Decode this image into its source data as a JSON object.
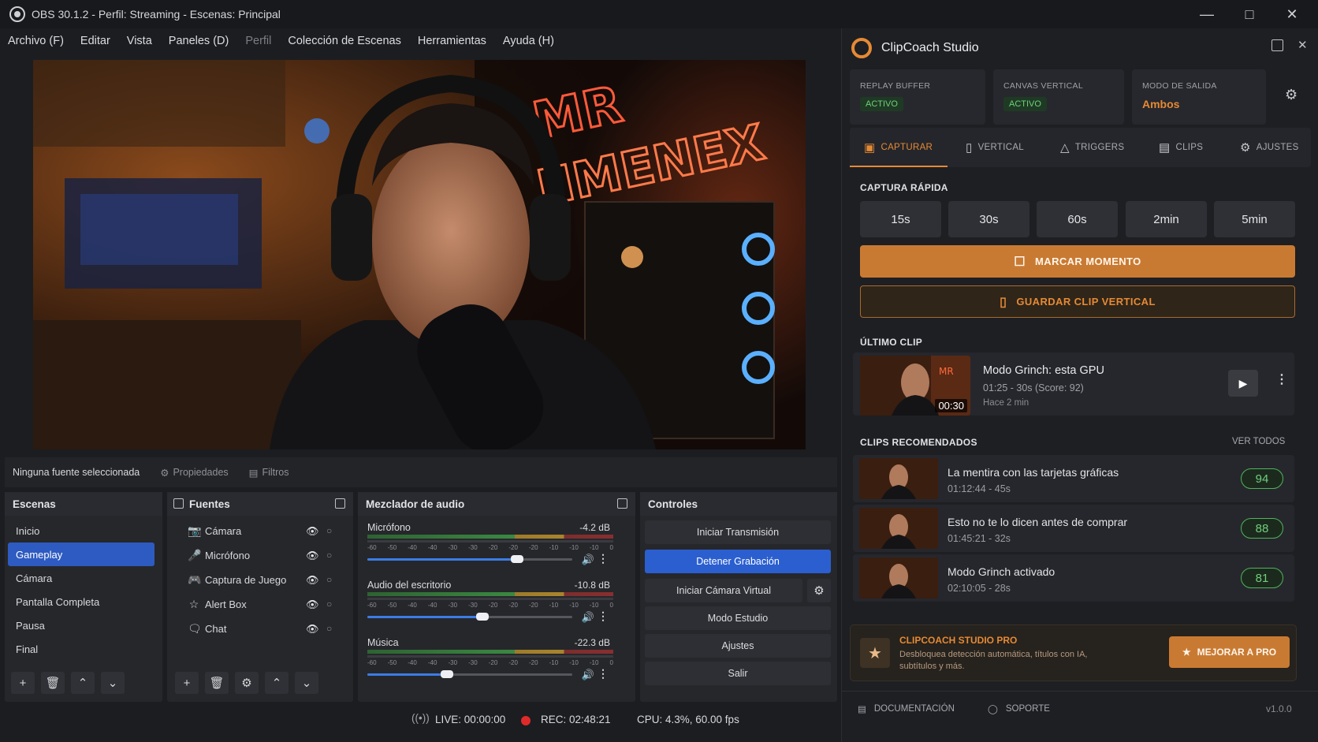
{
  "window": {
    "title": "OBS 30.1.2 - Perfil: Streaming - Escenas: Principal"
  },
  "menu": [
    "Archivo (F)",
    "Editar",
    "Vista",
    "Paneles (D)",
    "Perfil",
    "Colección de Escenas",
    "Herramientas",
    "Ayuda (H)"
  ],
  "preview": {
    "neon_line1": "MR",
    "neon_line2": "JIMENEX"
  },
  "source_bar": {
    "status": "Ninguna fuente seleccionada",
    "properties": "Propiedades",
    "filters": "Filtros"
  },
  "scenes": {
    "title": "Escenas",
    "items": [
      "Inicio",
      "Gameplay",
      "Cámara",
      "Pantalla Completa",
      "Pausa",
      "Final"
    ],
    "selected": "Gameplay"
  },
  "sources": {
    "title": "Fuentes",
    "items": [
      {
        "label": "Cámara",
        "icon": "camera-icon"
      },
      {
        "label": "Micrófono",
        "icon": "microphone-icon"
      },
      {
        "label": "Captura de Juego",
        "icon": "gamepad-icon"
      },
      {
        "label": "Alert Box",
        "icon": "star-icon"
      },
      {
        "label": "Chat",
        "icon": "chat-icon"
      }
    ]
  },
  "mixer": {
    "title": "Mezclador de audio",
    "ticks": [
      "-60",
      "-50",
      "-40",
      "-40",
      "-30",
      "-30",
      "-20",
      "-20",
      "-20",
      "-10",
      "-10",
      "-10",
      "0"
    ],
    "channels": [
      {
        "name": "Micrófono",
        "db": "-4.2 dB",
        "level": 0.73
      },
      {
        "name": "Audio del escritorio",
        "db": "-10.8 dB",
        "level": 0.56
      },
      {
        "name": "Música",
        "db": "-22.3 dB",
        "level": 0.39
      }
    ]
  },
  "controls": {
    "title": "Controles",
    "start_stream": "Iniciar Transmisión",
    "stop_record": "Detener Grabación",
    "virtual_cam": "Iniciar Cámara Virtual",
    "studio": "Modo Estudio",
    "settings": "Ajustes",
    "exit": "Salir"
  },
  "status": {
    "live": "LIVE: 00:00:00",
    "rec": "REC: 02:48:21",
    "cpu": "CPU: 4.3%,  60.00 fps"
  },
  "plugin": {
    "title": "ClipCoach Studio",
    "cards": [
      {
        "label": "REPLAY BUFFER",
        "value": "ACTIVO"
      },
      {
        "label": "CANVAS VERTICAL",
        "value": "ACTIVO"
      },
      {
        "label": "MODO DE SALIDA",
        "value": "Ambos"
      }
    ],
    "tabs": [
      "CAPTURAR",
      "VERTICAL",
      "TRIGGERS",
      "CLIPS",
      "AJUSTES"
    ],
    "quick_title": "CAPTURA RÁPIDA",
    "quick": [
      "15s",
      "30s",
      "60s",
      "2min",
      "5min"
    ],
    "mark": "MARCAR MOMENTO",
    "save_vertical": "GUARDAR CLIP VERTICAL",
    "last_title": "ÚLTIMO CLIP",
    "last_clip": {
      "title": "Modo Grinch: esta GPU",
      "meta": "01:25 - 30s (Score: 92)",
      "ago": "Hace 2 min",
      "duration": "00:30"
    },
    "rec_title": "CLIPS RECOMENDADOS",
    "see_all": "VER TODOS",
    "recommended": [
      {
        "title": "La mentira con las tarjetas gráficas",
        "meta": "01:12:44 - 45s",
        "score": "94"
      },
      {
        "title": "Esto no te lo dicen antes de comprar",
        "meta": "01:45:21 - 32s",
        "score": "88"
      },
      {
        "title": "Modo Grinch activado",
        "meta": "02:10:05 - 28s",
        "score": "81"
      }
    ],
    "pro": {
      "title": "CLIPCOACH STUDIO PRO",
      "desc": "Desbloquea detección automática, títulos con IA, subtítulos y más.",
      "button": "MEJORAR A PRO"
    },
    "footer": {
      "docs": "DOCUMENTACIÓN",
      "support": "SOPORTE",
      "version": "v1.0.0"
    }
  },
  "colors": {
    "accent": "#e58a35",
    "obs_blue": "#2e5bc1",
    "score_green": "#4fb35c"
  }
}
